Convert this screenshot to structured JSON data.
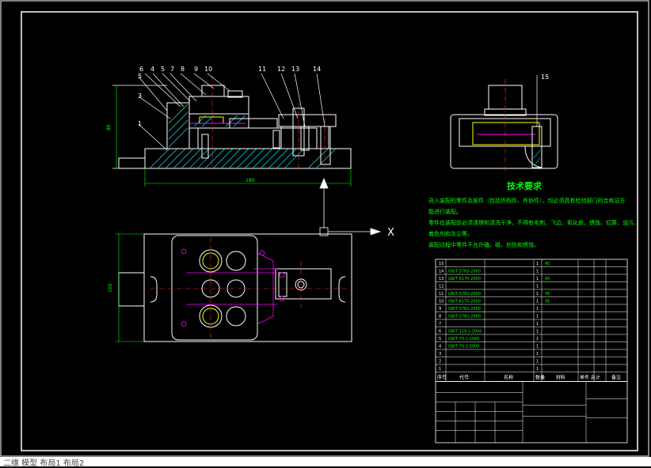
{
  "drawing": {
    "part_labels_top": [
      "6",
      "4",
      "5",
      "7",
      "8",
      "9",
      "10",
      "11",
      "12",
      "13",
      "14"
    ],
    "part_labels_side": [
      "5",
      "3",
      "1"
    ],
    "part_label_right": "15",
    "dimension_width": "180",
    "dimension_height_front": "86",
    "dimension_height_plan": "100",
    "axis_x": "X",
    "tech_title": "技术要求",
    "tech_notes": [
      "进入装配的零件及部件（包括外购件、外协件），均必须具有检验部门的合格证方",
      "能进行装配。",
      "零件在装配前必须清理和清洗干净，不得有毛刺、飞边、氧化皮、锈蚀、切屑、油污、",
      "着色剂和灰尘等。",
      "装配过程中零件不允许磕、碰、划伤和锈蚀。"
    ]
  },
  "bom": {
    "rows": [
      {
        "no": "15",
        "code": "",
        "name": "",
        "qty": "1",
        "mat": "45",
        "note": ""
      },
      {
        "no": "14",
        "code": "GB/T 5783-2000",
        "name": "",
        "qty": "1",
        "mat": "",
        "note": ""
      },
      {
        "no": "13",
        "code": "GB/T 6170-2000",
        "name": "",
        "qty": "1",
        "mat": "45",
        "note": ""
      },
      {
        "no": "12",
        "code": "",
        "name": "",
        "qty": "1",
        "mat": "",
        "note": ""
      },
      {
        "no": "11",
        "code": "GB/T 5783-2000",
        "name": "",
        "qty": "1",
        "mat": "45",
        "note": ""
      },
      {
        "no": "10",
        "code": "GB/T 6170-2000",
        "name": "",
        "qty": "1",
        "mat": "45",
        "note": ""
      },
      {
        "no": "9",
        "code": "GB/T 5782-2000",
        "name": "",
        "qty": "1",
        "mat": "",
        "note": ""
      },
      {
        "no": "8",
        "code": "GB/T 5782-2000",
        "name": "",
        "qty": "1",
        "mat": "",
        "note": ""
      },
      {
        "no": "7",
        "code": "",
        "name": "",
        "qty": "1",
        "mat": "",
        "note": ""
      },
      {
        "no": "6",
        "code": "GB/T 119.1-2000",
        "name": "",
        "qty": "1",
        "mat": "",
        "note": ""
      },
      {
        "no": "5",
        "code": "GB/T 70.1-2000",
        "name": "",
        "qty": "1",
        "mat": "",
        "note": ""
      },
      {
        "no": "4",
        "code": "GB/T 70.1-2000",
        "name": "",
        "qty": "1",
        "mat": "",
        "note": ""
      },
      {
        "no": "3",
        "code": "",
        "name": "",
        "qty": "1",
        "mat": "",
        "note": ""
      },
      {
        "no": "2",
        "code": "",
        "name": "",
        "qty": "1",
        "mat": "",
        "note": ""
      },
      {
        "no": "1",
        "code": "",
        "name": "",
        "qty": "1",
        "mat": "",
        "note": ""
      }
    ],
    "header": {
      "no": "序号",
      "code": "代号",
      "name": "名称",
      "qty": "数量",
      "mat": "材料",
      "weight": "单件 总计",
      "note": "备注"
    }
  },
  "statusbar": {
    "text": "二维 模型 布局1 布局2"
  },
  "colors": {
    "bg": "#000000",
    "line": "#ffffff",
    "green": "#00ff00",
    "cyan": "#00ffff",
    "magenta": "#ff00ff",
    "yellow": "#ffff00",
    "red": "#ff3333"
  }
}
